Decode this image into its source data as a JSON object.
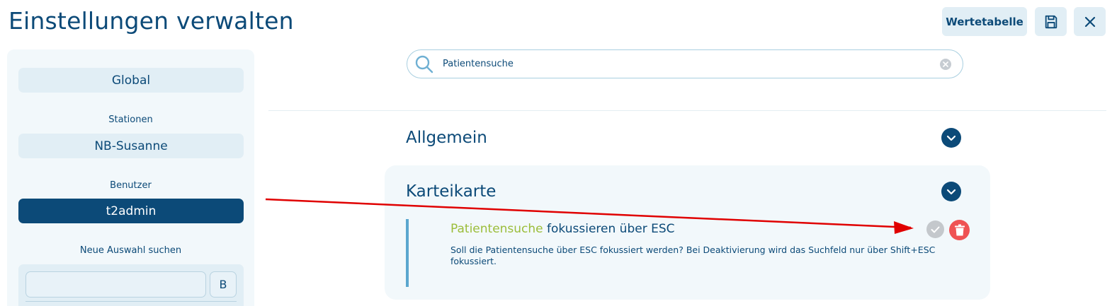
{
  "header": {
    "title": "Einstellungen verwalten",
    "wertetabelle_label": "Wertetabelle",
    "save_icon": "floppy-disk-icon",
    "close_icon": "x-icon"
  },
  "sidebar": {
    "global_label": "Global",
    "stationen_heading": "Stationen",
    "station_value": "NB-Susanne",
    "benutzer_heading": "Benutzer",
    "benutzer_value": "t2admin",
    "neue_auswahl_heading": "Neue Auswahl suchen",
    "search_value": "",
    "b_button_label": "B"
  },
  "search": {
    "value": "Patientensuche",
    "icon": "magnifier-icon"
  },
  "sections": {
    "allgemein": {
      "title": "Allgemein"
    },
    "karteikarte": {
      "title": "Karteikarte",
      "setting": {
        "title_highlight": "Patientensuche",
        "title_rest": " fokussieren über ESC",
        "description": "Soll die Patientensuche über ESC fokussiert werden? Bei Deaktivierung wird das Suchfeld nur über Shift+ESC fokussiert."
      }
    }
  },
  "colors": {
    "primary": "#0c4a78",
    "light": "#e1eef5",
    "highlight": "#9bbd3a",
    "delete": "#ef5253",
    "arrow": "#e00000"
  }
}
